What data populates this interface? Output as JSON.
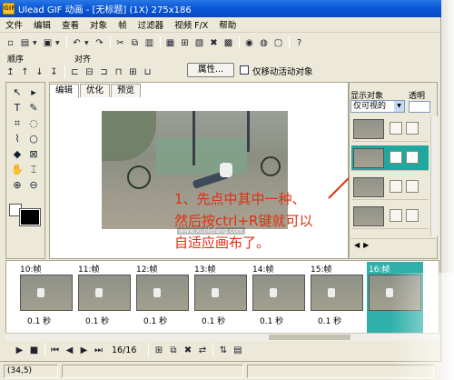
{
  "window": {
    "title": "Ulead GIF 动画 - [无标题] (1X) 275x186",
    "app_icon": "GIF"
  },
  "menu": [
    "文件",
    "编辑",
    "查看",
    "对象",
    "帧",
    "过滤器",
    "视频 F/X",
    "帮助"
  ],
  "toolbar1": {
    "icons": [
      "new-icon",
      "open-icon",
      "save-icon",
      "undo-icon",
      "redo-icon",
      "cut-icon",
      "copy-icon",
      "paste-icon",
      "frame-icon",
      "resize-icon",
      "tool-icon",
      "delete-icon",
      "grid-icon",
      "web-icon",
      "export-icon",
      "help-icon"
    ]
  },
  "toolbar2": {
    "order_label": "顺序",
    "align_label": "对齐",
    "properties_button": "属性...",
    "only_move_active_label": "仅移动活动对象"
  },
  "editor": {
    "tabs": [
      "编辑",
      "优化",
      "预览"
    ],
    "active_tab": "编辑",
    "overlay": [
      "1、先点中其中一种、",
      "然后按ctrl+R键就可以",
      "自适应画布了。"
    ],
    "watermark": "www.xunlefang.com"
  },
  "object_panel": {
    "display_label": "显示对象",
    "opacity_label": "透明",
    "filter_value": "仅可视的",
    "opacity_value": "",
    "rows": 5,
    "selected_row": 1
  },
  "frames": [
    {
      "num": "10:帧",
      "delay": "0.1 秒"
    },
    {
      "num": "11:帧",
      "delay": "0.1 秒"
    },
    {
      "num": "12:帧",
      "delay": "0.1 秒"
    },
    {
      "num": "13:帧",
      "delay": "0.1 秒"
    },
    {
      "num": "14:帧",
      "delay": "0.1 秒"
    },
    {
      "num": "15:帧",
      "delay": "0.1 秒"
    },
    {
      "num": "16:帧",
      "delay": ""
    }
  ],
  "playback": {
    "counter": "16/16"
  },
  "status": {
    "coords": "(34,5)"
  },
  "colors": {
    "titlebar": "#0a58d8",
    "selection": "#2fb0aa",
    "overlay_text": "#e03010"
  }
}
